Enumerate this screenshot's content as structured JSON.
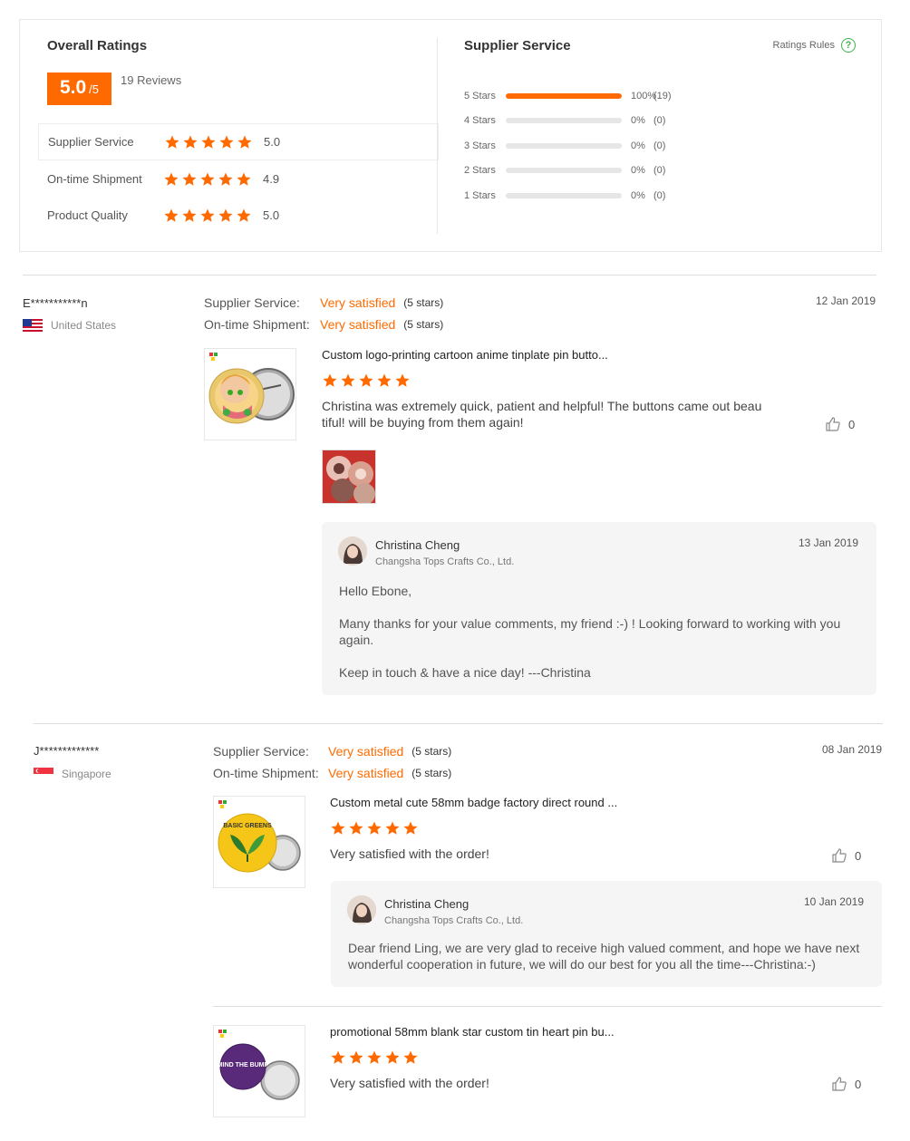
{
  "overall": {
    "title": "Overall Ratings",
    "score": "5.0",
    "score_max": "/5",
    "reviews_count": "19 Reviews",
    "categories": [
      {
        "label": "Supplier Service",
        "value": "5.0",
        "stars": 5
      },
      {
        "label": "On-time Shipment",
        "value": "4.9",
        "stars": 5
      },
      {
        "label": "Product Quality",
        "value": "5.0",
        "stars": 5
      }
    ]
  },
  "supplier_service": {
    "title": "Supplier Service",
    "rules_label": "Ratings Rules",
    "help_icon": "question-circle-icon",
    "breakdown": [
      {
        "label": "5 Stars",
        "percent": 100,
        "pct_text": "100%",
        "count": "(19)"
      },
      {
        "label": "4 Stars",
        "percent": 0,
        "pct_text": "0%",
        "count": "(0)"
      },
      {
        "label": "3 Stars",
        "percent": 0,
        "pct_text": "0%",
        "count": "(0)"
      },
      {
        "label": "2 Stars",
        "percent": 0,
        "pct_text": "0%",
        "count": "(0)"
      },
      {
        "label": "1 Stars",
        "percent": 0,
        "pct_text": "0%",
        "count": "(0)"
      }
    ]
  },
  "colors": {
    "accent": "#ff6a00",
    "help": "#3fb34f",
    "bar_track": "#e6e6e6"
  },
  "reviews": [
    {
      "reviewer": "E***********n",
      "country": "United States",
      "flag_icon": "us-flag-icon",
      "supplier_label": "Supplier Service:",
      "supplier_value": "Very satisfied",
      "supplier_stars": "(5 stars)",
      "shipment_label": "On-time Shipment:",
      "shipment_value": "Very satisfied",
      "shipment_stars": "(5 stars)",
      "date": "12 Jan 2019",
      "products": [
        {
          "title": "Custom logo-printing cartoon anime tinplate pin butto...",
          "stars": 5,
          "comment": "Christina was extremely quick, patient and helpful! The buttons came out beau tiful! will be buying from them again!",
          "likes": "0",
          "reply": {
            "name": "Christina Cheng",
            "company": "Changsha Tops Crafts Co., Ltd.",
            "date": "13 Jan 2019",
            "line1": "Hello Ebone,",
            "line2": "Many thanks for your value comments, my friend :-) !  Looking forward to working with you again.",
            "line3": "Keep in touch & have a nice day! ---Christina"
          }
        }
      ]
    },
    {
      "reviewer": "J*************",
      "country": "Singapore",
      "flag_icon": "singapore-flag-icon",
      "supplier_label": "Supplier Service:",
      "supplier_value": "Very satisfied",
      "supplier_stars": "(5 stars)",
      "shipment_label": "On-time Shipment:",
      "shipment_value": "Very satisfied",
      "shipment_stars": "(5 stars)",
      "date": "08 Jan 2019",
      "products": [
        {
          "title": "Custom metal cute 58mm badge factory direct round ...",
          "stars": 5,
          "comment": "Very satisfied with the order!",
          "likes": "0",
          "badge_text": "BASIC GREENS",
          "reply": {
            "name": "Christina Cheng",
            "company": "Changsha Tops Crafts Co., Ltd.",
            "date": "10 Jan 2019",
            "text": "Dear friend Ling, we are very glad to receive high valued comment, and hope we have next wonderful cooperation in future, we will do our best for you all the time---Christina:-)"
          }
        },
        {
          "title": "promotional 58mm blank star custom tin heart pin bu...",
          "stars": 5,
          "comment": "Very satisfied with the order!",
          "likes": "0",
          "badge_text": "MIND THE BUMP"
        }
      ]
    }
  ]
}
